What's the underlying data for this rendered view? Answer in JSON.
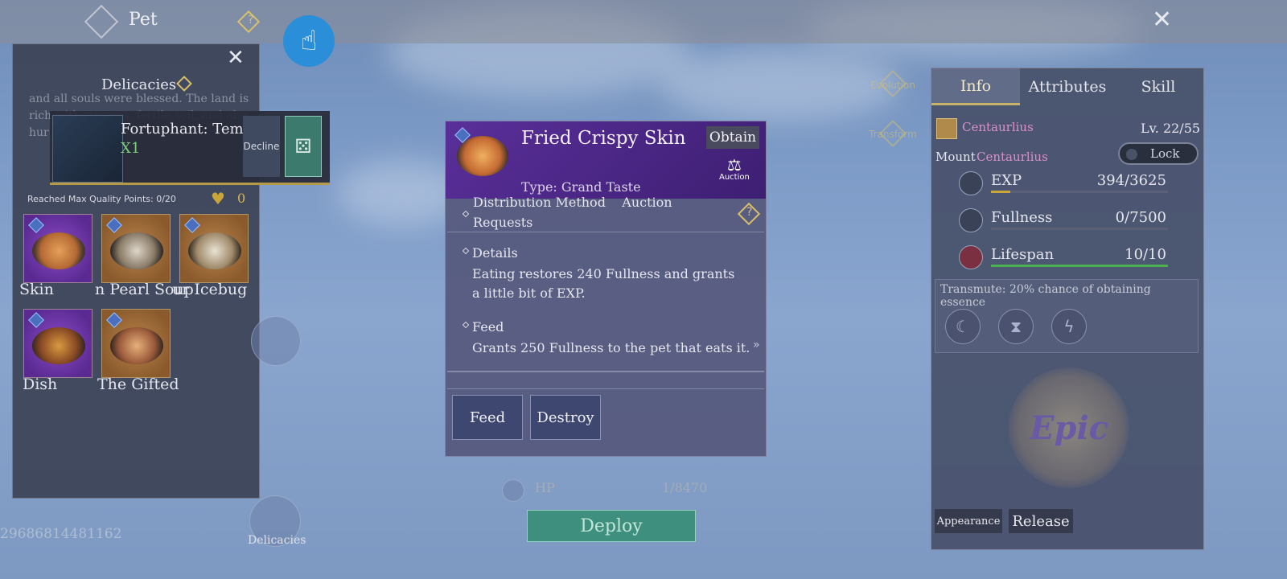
{
  "topbar": {
    "title": "Pet",
    "help_icon": "question-icon",
    "close_icon": "close-icon",
    "help_symbol": "?",
    "close_symbol": "✕"
  },
  "left_panel": {
    "title": "Delicacies",
    "lore_text": "and all souls were blessed. The land is rich with streams, fertile soil, and abu hur The Aur",
    "quality_text": "Reached Max Quality Points: 0/20",
    "heart_count": "0",
    "close_symbol": "✕",
    "heart_symbol": "♥",
    "items": [
      {
        "label": "Skin",
        "color": "purple"
      },
      {
        "label": "n Pearl Soup",
        "color": "orange"
      },
      {
        "label": "ur Icebug",
        "color": "orange"
      },
      {
        "label": "Dish",
        "color": "purple"
      },
      {
        "label": "The Gifted",
        "color": "orange"
      }
    ]
  },
  "popup_card": {
    "name": "Fortuphant: Temp.",
    "quantity": "X1",
    "decline_label": "Decline",
    "dice_symbol": "⚄"
  },
  "detail": {
    "name": "Fried Crispy Skin",
    "obtain_label": "Obtain",
    "auction_label": "Auction",
    "type_text": "Type: Grand Taste",
    "distribution_line1": "Distribution Method    Auction",
    "distribution_line2": "Requests",
    "details_title": "Details",
    "details_text": "Eating restores 240 Fullness and grants a little bit of EXP.",
    "feed_title": "Feed",
    "feed_text": "Grants 250 Fullness to the pet that eats it.",
    "feed_button": "Feed",
    "destroy_button": "Destroy",
    "help_symbol": "?",
    "scroll_symbol": "»",
    "auction_symbol": "⚖"
  },
  "bottom": {
    "hp_label": "HP",
    "hp_value": "1/8470",
    "deploy_label": "Deploy",
    "id_text": "29686814481162",
    "delicacies_label": "Delicacies"
  },
  "side": {
    "evolution_label": "Evolution",
    "transform_label": "Transform"
  },
  "right_panel": {
    "tabs": [
      "Info",
      "Attributes",
      "Skill"
    ],
    "active_tab": "Info",
    "pet_name": "Centaurlius",
    "level": "Lv. 22/55",
    "mount_label": "Mount",
    "mount_name": "Centaurlius",
    "lock_label": "Lock",
    "stats": [
      {
        "label": "EXP",
        "value": "394/3625",
        "fill": 0.109,
        "color": "#c9a63a"
      },
      {
        "label": "Fullness",
        "value": "0/7500",
        "fill": 0,
        "color": "#c9a63a"
      },
      {
        "label": "Lifespan",
        "value": "10/10",
        "fill": 1,
        "color": "#4caf50"
      }
    ],
    "transmute_text": "Transmute: 20% chance of obtaining essence",
    "essence_icons": [
      "moon-essence-icon",
      "hourglass-essence-icon",
      "lightning-essence-icon"
    ],
    "rarity": "Epic",
    "appearance_button": "Appearance",
    "release_button": "Release"
  }
}
